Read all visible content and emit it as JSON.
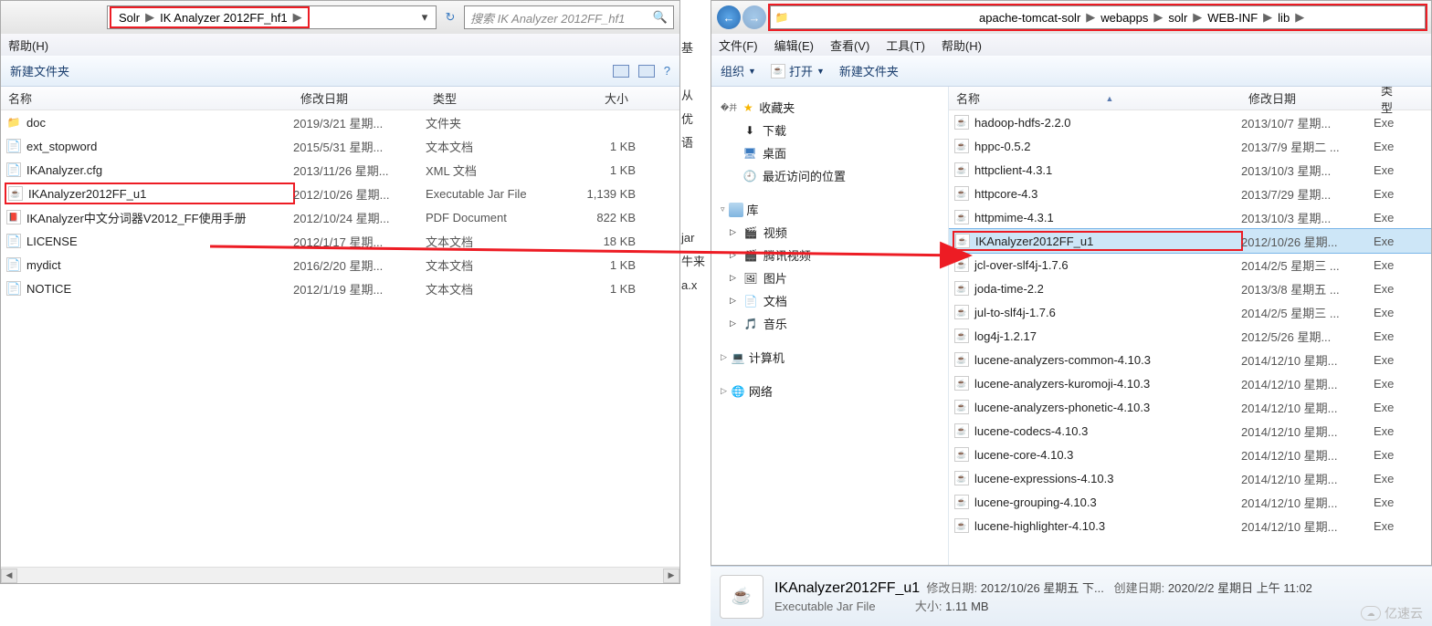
{
  "left": {
    "breadcrumb": {
      "items": [
        "Solr",
        "IK Analyzer 2012FF_hf1"
      ]
    },
    "search_placeholder": "搜索 IK Analyzer 2012FF_hf1",
    "menubar": {
      "help": "帮助(H)"
    },
    "toolbar": {
      "newfolder": "新建文件夹"
    },
    "columns": {
      "name": "名称",
      "date": "修改日期",
      "type": "类型",
      "size": "大小"
    },
    "files": [
      {
        "icon": "folder",
        "name": "doc",
        "date": "2019/3/21 星期...",
        "type": "文件夹",
        "size": ""
      },
      {
        "icon": "file",
        "name": "ext_stopword",
        "date": "2015/5/31 星期...",
        "type": "文本文档",
        "size": "1 KB"
      },
      {
        "icon": "file",
        "name": "IKAnalyzer.cfg",
        "date": "2013/11/26 星期...",
        "type": "XML 文档",
        "size": "1 KB"
      },
      {
        "icon": "jar",
        "name": "IKAnalyzer2012FF_u1",
        "date": "2012/10/26 星期...",
        "type": "Executable Jar File",
        "size": "1,139 KB",
        "highlight": true
      },
      {
        "icon": "pdf",
        "name": "IKAnalyzer中文分词器V2012_FF使用手册",
        "date": "2012/10/24 星期...",
        "type": "PDF Document",
        "size": "822 KB"
      },
      {
        "icon": "file",
        "name": "LICENSE",
        "date": "2012/1/17 星期...",
        "type": "文本文档",
        "size": "18 KB"
      },
      {
        "icon": "file",
        "name": "mydict",
        "date": "2016/2/20 星期...",
        "type": "文本文档",
        "size": "1 KB"
      },
      {
        "icon": "file",
        "name": "NOTICE",
        "date": "2012/1/19 星期...",
        "type": "文本文档",
        "size": "1 KB"
      }
    ]
  },
  "right": {
    "breadcrumb": {
      "items": [
        "apache-tomcat-solr",
        "webapps",
        "solr",
        "WEB-INF",
        "lib"
      ]
    },
    "menubar": {
      "file": "文件(F)",
      "edit": "编辑(E)",
      "view": "查看(V)",
      "tools": "工具(T)",
      "help": "帮助(H)"
    },
    "toolbar": {
      "organize": "组织",
      "open": "打开",
      "newfolder": "新建文件夹"
    },
    "nav": {
      "favorites": "收藏夹",
      "downloads": "下载",
      "desktop": "桌面",
      "recent": "最近访问的位置",
      "libraries": "库",
      "videos": "视频",
      "tencent": "腾讯视频",
      "pictures": "图片",
      "documents": "文档",
      "music": "音乐",
      "computer": "计算机",
      "network": "网络"
    },
    "columns": {
      "name": "名称",
      "date": "修改日期",
      "type": "类型"
    },
    "files": [
      {
        "name": "hadoop-hdfs-2.2.0",
        "date": "2013/10/7 星期...",
        "type": "Exe"
      },
      {
        "name": "hppc-0.5.2",
        "date": "2013/7/9 星期二 ...",
        "type": "Exe"
      },
      {
        "name": "httpclient-4.3.1",
        "date": "2013/10/3 星期...",
        "type": "Exe"
      },
      {
        "name": "httpcore-4.3",
        "date": "2013/7/29 星期...",
        "type": "Exe"
      },
      {
        "name": "httpmime-4.3.1",
        "date": "2013/10/3 星期...",
        "type": "Exe"
      },
      {
        "name": "IKAnalyzer2012FF_u1",
        "date": "2012/10/26 星期...",
        "type": "Exe",
        "selected": true,
        "highlight": true
      },
      {
        "name": "jcl-over-slf4j-1.7.6",
        "date": "2014/2/5 星期三 ...",
        "type": "Exe"
      },
      {
        "name": "joda-time-2.2",
        "date": "2013/3/8 星期五 ...",
        "type": "Exe"
      },
      {
        "name": "jul-to-slf4j-1.7.6",
        "date": "2014/2/5 星期三 ...",
        "type": "Exe"
      },
      {
        "name": "log4j-1.2.17",
        "date": "2012/5/26 星期...",
        "type": "Exe"
      },
      {
        "name": "lucene-analyzers-common-4.10.3",
        "date": "2014/12/10 星期...",
        "type": "Exe"
      },
      {
        "name": "lucene-analyzers-kuromoji-4.10.3",
        "date": "2014/12/10 星期...",
        "type": "Exe"
      },
      {
        "name": "lucene-analyzers-phonetic-4.10.3",
        "date": "2014/12/10 星期...",
        "type": "Exe"
      },
      {
        "name": "lucene-codecs-4.10.3",
        "date": "2014/12/10 星期...",
        "type": "Exe"
      },
      {
        "name": "lucene-core-4.10.3",
        "date": "2014/12/10 星期...",
        "type": "Exe"
      },
      {
        "name": "lucene-expressions-4.10.3",
        "date": "2014/12/10 星期...",
        "type": "Exe"
      },
      {
        "name": "lucene-grouping-4.10.3",
        "date": "2014/12/10 星期...",
        "type": "Exe"
      },
      {
        "name": "lucene-highlighter-4.10.3",
        "date": "2014/12/10 星期...",
        "type": "Exe"
      }
    ]
  },
  "details": {
    "name": "IKAnalyzer2012FF_u1",
    "type": "Executable Jar File",
    "mod_label": "修改日期:",
    "mod_value": "2012/10/26 星期五 下...",
    "create_label": "创建日期:",
    "create_value": "2020/2/2 星期日 上午 11:02",
    "size_label": "大小:",
    "size_value": "1.11 MB"
  },
  "middle_text": [
    "基",
    "",
    "从",
    "优",
    "语",
    "",
    "",
    "",
    "jar",
    "牛来",
    "a.x"
  ],
  "watermark": "亿速云"
}
